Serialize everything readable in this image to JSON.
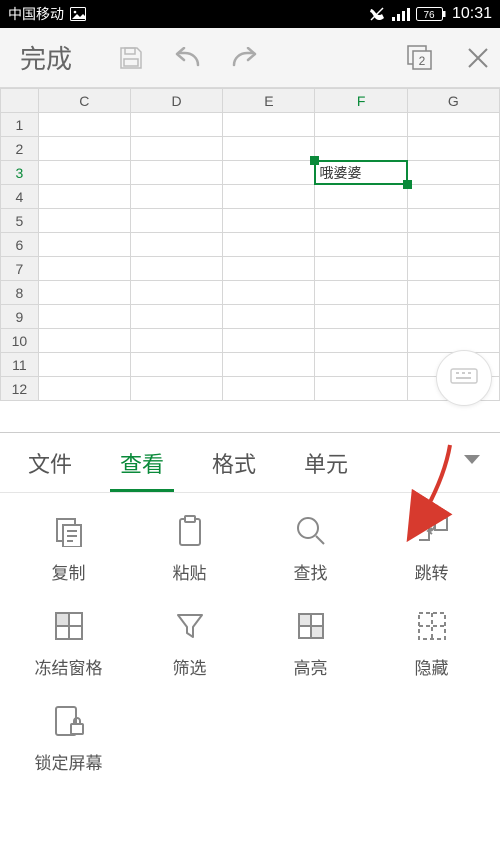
{
  "status": {
    "carrier": "中国移动",
    "battery": "76",
    "time": "10:31"
  },
  "toolbar": {
    "done": "完成",
    "sheet_count": "2"
  },
  "sheet": {
    "cols": [
      "C",
      "D",
      "E",
      "F",
      "G"
    ],
    "rows": [
      "1",
      "2",
      "3",
      "4",
      "5",
      "6",
      "7",
      "8",
      "9",
      "10",
      "11",
      "12"
    ],
    "selected_col": "F",
    "selected_row": "3",
    "cell_value": "哦婆婆"
  },
  "tabs": {
    "t1": "文件",
    "t2": "查看",
    "t3": "格式",
    "t4": "单元"
  },
  "tools": {
    "copy": "复制",
    "paste": "粘贴",
    "find": "查找",
    "goto": "跳转",
    "freeze": "冻结窗格",
    "filter": "筛选",
    "highlight": "高亮",
    "hide": "隐藏",
    "lock": "锁定屏幕"
  }
}
